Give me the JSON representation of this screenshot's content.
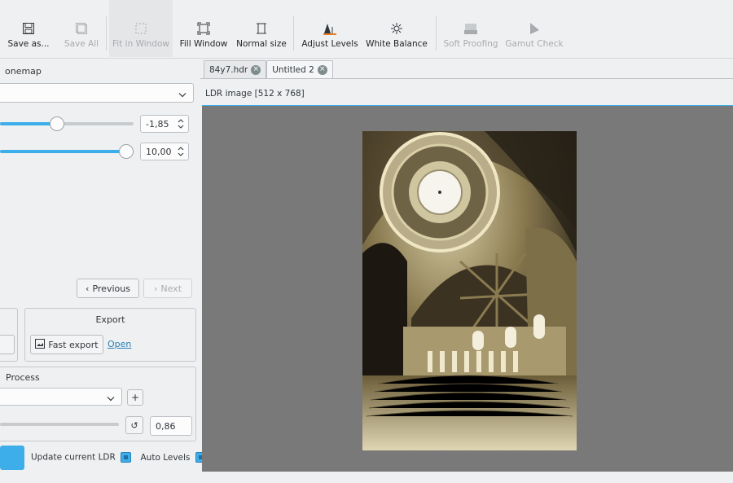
{
  "toolbar": {
    "items": [
      {
        "label": "Save as...",
        "icon": "save-icon",
        "disabled": false
      },
      {
        "label": "Save All",
        "icon": "save-all-icon",
        "disabled": true
      },
      {
        "label": "Fit in Window",
        "icon": "fit-window-icon",
        "disabled": true
      },
      {
        "label": "Fill Window",
        "icon": "fill-window-icon",
        "disabled": false
      },
      {
        "label": "Normal size",
        "icon": "normal-size-icon",
        "disabled": false
      },
      {
        "label": "Adjust Levels",
        "icon": "adjust-levels-icon",
        "disabled": false
      },
      {
        "label": "White Balance",
        "icon": "white-balance-icon",
        "disabled": false
      },
      {
        "label": "Soft Proofing",
        "icon": "soft-proofing-icon",
        "disabled": true
      },
      {
        "label": "Gamut Check",
        "icon": "gamut-check-icon",
        "disabled": true
      }
    ]
  },
  "left": {
    "tonemap_title": "onemap",
    "slider1_value": "-1,85",
    "slider1_level": 0.42,
    "slider2_value": "10,00",
    "slider2_level": 1.0,
    "previous_label": "Previous",
    "next_label": "Next",
    "export_title": "Export",
    "fast_export_label": "Fast export",
    "open_label": "Open",
    "process_title": "Process",
    "add_label": "+",
    "reset_label": "↺",
    "process_value": "0,86",
    "update_ldr_label": "Update current LDR",
    "auto_levels_label": "Auto Levels",
    "update_ldr_checked": true,
    "auto_levels_checked": true
  },
  "tabs": [
    {
      "label": "84y7.hdr",
      "selected": false
    },
    {
      "label": "Untitled 2",
      "selected": true
    }
  ],
  "viewer": {
    "subtitle": "LDR image [512 x 768]"
  },
  "colors": {
    "accent": "#3daee9",
    "viewer_bg": "#797979",
    "panel_bg": "#eff0f1"
  }
}
